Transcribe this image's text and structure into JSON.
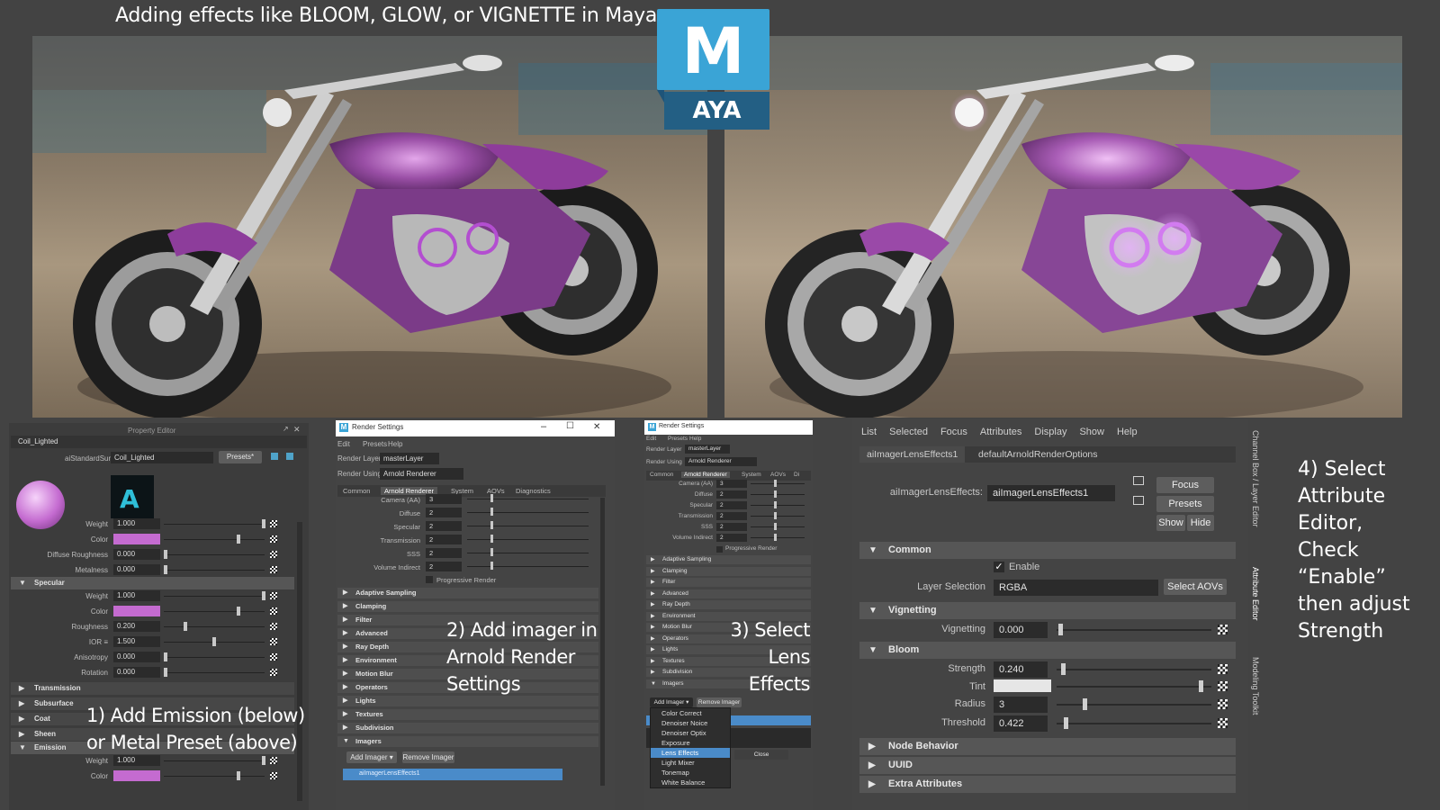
{
  "headline": "Adding effects like BLOOM, GLOW, or VIGNETTE in Maya",
  "logo": {
    "letter": "M",
    "text": "AYA"
  },
  "property_editor": {
    "title": "Property Editor",
    "node_name": "Coil_Lighted",
    "shader_label": "aiStandardSurface:",
    "shader_value": "Coil_Lighted",
    "presets_label": "Presets*",
    "rows_top": [
      {
        "label": "Weight",
        "value": "1.000"
      },
      {
        "label": "Color",
        "value": ""
      },
      {
        "label": "Diffuse Roughness",
        "value": "0.000"
      },
      {
        "label": "Metalness",
        "value": "0.000"
      }
    ],
    "specular_title": "Specular",
    "specular_rows": [
      {
        "label": "Weight",
        "value": "1.000"
      },
      {
        "label": "Color",
        "value": ""
      },
      {
        "label": "Roughness",
        "value": "0.200"
      },
      {
        "label": "IOR ≡",
        "value": "1.500"
      },
      {
        "label": "Anisotropy",
        "value": "0.000"
      },
      {
        "label": "Rotation",
        "value": "0.000"
      }
    ],
    "collapsed": [
      "Transmission",
      "Subsurface",
      "Coat",
      "Sheen"
    ],
    "emission_title": "Emission",
    "emission_rows": [
      {
        "label": "Weight",
        "value": "1.000"
      },
      {
        "label": "Color",
        "value": ""
      }
    ]
  },
  "render_settings_1": {
    "title": "Render Settings",
    "menu": [
      "Edit",
      "Presets",
      "Help"
    ],
    "render_layer_label": "Render Layer",
    "render_layer_value": "masterLayer",
    "render_using_label": "Render Using",
    "render_using_value": "Arnold Renderer",
    "tabs": [
      "Common",
      "Arnold Renderer",
      "System",
      "AOVs",
      "Diagnostics"
    ],
    "rows": [
      {
        "label": "Camera (AA)",
        "value": "3"
      },
      {
        "label": "Diffuse",
        "value": "2"
      },
      {
        "label": "Specular",
        "value": "2"
      },
      {
        "label": "Transmission",
        "value": "2"
      },
      {
        "label": "SSS",
        "value": "2"
      },
      {
        "label": "Volume Indirect",
        "value": "2"
      }
    ],
    "progressive": "Progressive Render",
    "sections": [
      "Adaptive Sampling",
      "Clamping",
      "Filter",
      "Advanced",
      "Ray Depth",
      "Environment",
      "Motion Blur",
      "Operators",
      "Lights",
      "Textures",
      "Subdivision",
      "Imagers"
    ],
    "add_imager": "Add Imager",
    "remove_imager": "Remove Imager",
    "imager_item": "aiImagerLensEffects1"
  },
  "render_settings_2": {
    "title": "Render Settings",
    "menu": [
      "Edit",
      "Presets",
      "Help"
    ],
    "render_layer_label": "Render Layer",
    "render_layer_value": "masterLayer",
    "render_using_label": "Render Using",
    "render_using_value": "Arnold Renderer",
    "tabs": [
      "Common",
      "Arnold Renderer",
      "System",
      "AOVs",
      "Di"
    ],
    "rows": [
      {
        "label": "Camera (AA)",
        "value": "3"
      },
      {
        "label": "Diffuse",
        "value": "2"
      },
      {
        "label": "Specular",
        "value": "2"
      },
      {
        "label": "Transmission",
        "value": "2"
      },
      {
        "label": "SSS",
        "value": "2"
      },
      {
        "label": "Volume Indirect",
        "value": "2"
      }
    ],
    "progressive": "Progressive Render",
    "sections": [
      "Adaptive Sampling",
      "Clamping",
      "Filter",
      "Advanced",
      "Ray Depth",
      "Environment",
      "Motion Blur",
      "Operators",
      "Lights",
      "Textures",
      "Subdivision",
      "Imagers"
    ],
    "add_imager": "Add Imager",
    "remove_imager": "Remove Imager",
    "dropdown": [
      "Color Correct",
      "Denoiser Noice",
      "Denoiser Optix",
      "Exposure",
      "Lens Effects",
      "Light Mixer",
      "Tonemap",
      "White Balance"
    ],
    "dropdown_selected_index": 4,
    "close_label": "Close"
  },
  "attribute_editor": {
    "menu": [
      "List",
      "Selected",
      "Focus",
      "Attributes",
      "Display",
      "Show",
      "Help"
    ],
    "tabs": [
      "aiImagerLensEffects1",
      "defaultArnoldRenderOptions"
    ],
    "node_label": "aiImagerLensEffects:",
    "node_value": "aiImagerLensEffects1",
    "focus": "Focus",
    "presets": "Presets",
    "show": "Show",
    "hide": "Hide",
    "common_title": "Common",
    "enable_label": "Enable",
    "enable_checked": true,
    "layer_selection_label": "Layer Selection",
    "layer_selection_value": "RGBA",
    "select_aovs": "Select AOVs",
    "vignetting_title": "Vignetting",
    "vignetting_label": "Vignetting",
    "vignetting_value": "0.000",
    "bloom_title": "Bloom",
    "strength_label": "Strength",
    "strength_value": "0.240",
    "tint_label": "Tint",
    "radius_label": "Radius",
    "radius_value": "3",
    "threshold_label": "Threshold",
    "threshold_value": "0.422",
    "collapsed": [
      "Node Behavior",
      "UUID",
      "Extra Attributes"
    ]
  },
  "side_tabs": [
    "Channel Box / Layer Editor",
    "Attribute Editor",
    "Modeling Toolkit"
  ],
  "steps": {
    "step1_line1": "1) Add Emission (below)",
    "step1_line2": "or Metal Preset (above)",
    "step2_line1": "2) Add imager in",
    "step2_line2": "Arnold Render",
    "step2_line3": "Settings",
    "step3_line1": "3) Select",
    "step3_line2": "Lens",
    "step3_line3": "Effects",
    "step4_line1": "4) Select",
    "step4_line2": "Attribute",
    "step4_line3": "Editor,",
    "step4_line4": "Check",
    "step4_line5": "“Enable”",
    "step4_line6": "then adjust",
    "step4_line7": "Strength"
  },
  "colors": {
    "accent_blue": "#3aa4d6",
    "purple": "#c46bd0",
    "selection": "#4a8bc9"
  }
}
